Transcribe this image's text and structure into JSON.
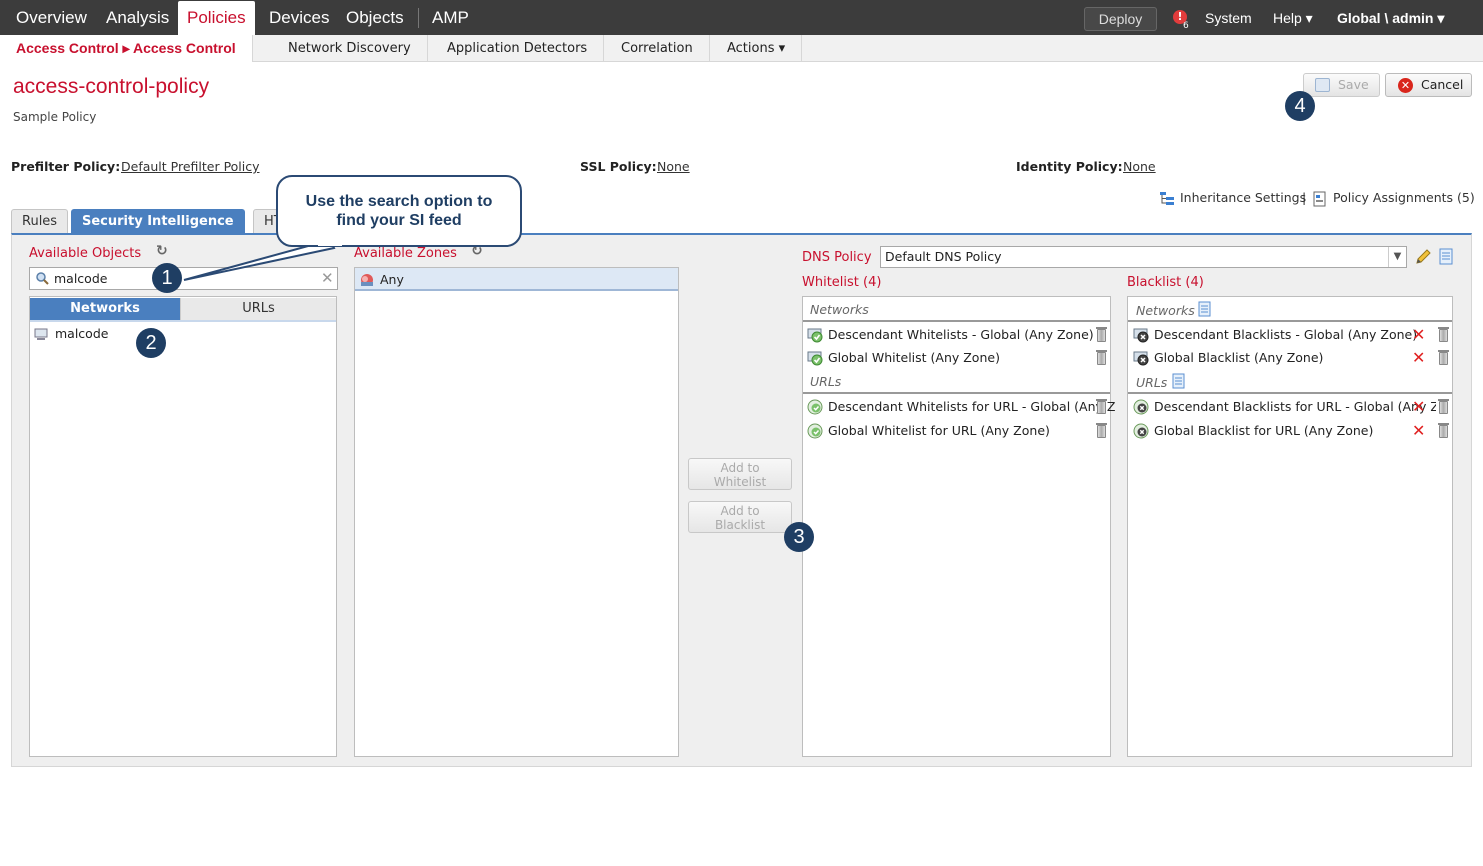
{
  "topnav": {
    "items": [
      "Overview",
      "Analysis",
      "Policies",
      "Devices",
      "Objects",
      "AMP"
    ],
    "deploy": "Deploy",
    "alert_icon": "!",
    "alert_count": "6",
    "system": "System",
    "help": "Help ▾",
    "user": "Global \\ admin ▾"
  },
  "subnav": {
    "active": "Access Control ▸ Access Control",
    "items": [
      "Network Discovery",
      "Application Detectors",
      "Correlation",
      "Actions ▾"
    ]
  },
  "page": {
    "title": "access-control-policy",
    "subtitle": "Sample Policy",
    "save": "Save",
    "cancel": "Cancel"
  },
  "policies": {
    "prefilter_label": "Prefilter Policy:",
    "prefilter_value": "Default Prefilter Policy",
    "ssl_label": "SSL Policy:",
    "ssl_value": "None",
    "identity_label": "Identity Policy:",
    "identity_value": "None"
  },
  "links": {
    "inheritance": "Inheritance Settings",
    "separator": "|",
    "assignments": "Policy Assignments (5)"
  },
  "tabs": [
    "Rules",
    "Security Intelligence",
    "HT"
  ],
  "available_objects": {
    "label": "Available Objects",
    "search_value": "malcode",
    "segments": [
      "Networks",
      "URLs"
    ],
    "items": [
      "malcode"
    ]
  },
  "available_zones": {
    "label": "Available Zones",
    "items": [
      "Any"
    ]
  },
  "add_buttons": {
    "whitelist": [
      "Add to",
      "Whitelist"
    ],
    "blacklist": [
      "Add to",
      "Blacklist"
    ]
  },
  "dns": {
    "label": "DNS Policy",
    "value": "Default DNS Policy"
  },
  "whitelist": {
    "title": "Whitelist (4)",
    "networks_header": "Networks",
    "networks": [
      "Descendant Whitelists - Global (Any Zone)",
      "Global Whitelist (Any Zone)"
    ],
    "urls_header": "URLs",
    "urls": [
      "Descendant Whitelists for URL - Global (Any Z",
      "Global Whitelist for URL (Any Zone)"
    ]
  },
  "blacklist": {
    "title": "Blacklist (4)",
    "networks_header": "Networks",
    "networks": [
      "Descendant Blacklists - Global (Any Zone)",
      "Global Blacklist (Any Zone)"
    ],
    "urls_header": "URLs",
    "urls": [
      "Descendant Blacklists for URL - Global (Any Zone",
      "Global Blacklist for URL (Any Zone)"
    ]
  },
  "annotations": {
    "callout": [
      "Use the search option to",
      "find your SI feed"
    ],
    "markers": [
      "1",
      "2",
      "3",
      "4"
    ]
  },
  "colors": {
    "accent_red": "#c8102e",
    "tab_blue": "#4a7fbf",
    "marker_navy": "#1f3e63",
    "topbar": "#3c3c3c"
  }
}
